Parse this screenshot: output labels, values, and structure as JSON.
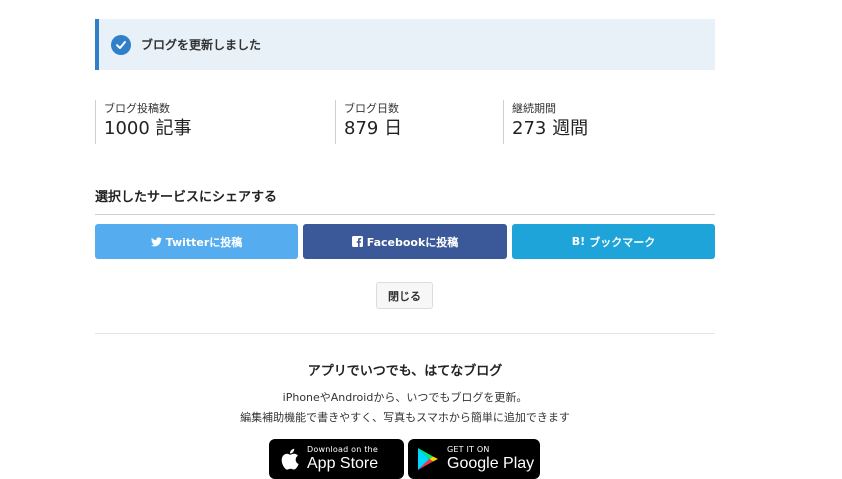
{
  "notice": {
    "message": "ブログを更新しました"
  },
  "stats": [
    {
      "label": "ブログ投稿数",
      "value": "1000 記事"
    },
    {
      "label": "ブログ日数",
      "value": "879 日"
    },
    {
      "label": "継続期間",
      "value": "273 週間"
    }
  ],
  "share": {
    "title": "選択したサービスにシェアする",
    "twitter_label": "Twitterに投稿",
    "facebook_label": "Facebookに投稿",
    "hatena_label": "ブックマーク",
    "hatena_mark": "B!",
    "close_label": "閉じる"
  },
  "app": {
    "title": "アプリでいつでも、はてなブログ",
    "line1": "iPhoneやAndroidから、いつでもブログを更新。",
    "line2": "編集補助機能で書きやすく、写真もスマホから簡単に追加できます",
    "appstore_small": "Download on the",
    "appstore_big": "App Store",
    "googleplay_small": "GET IT ON",
    "googleplay_big": "Google Play"
  },
  "colors": {
    "notice_bg": "#e8f0f8",
    "notice_accent": "#2f80c8",
    "twitter": "#55acee",
    "facebook": "#3b5998",
    "hatena": "#1fa4d9"
  }
}
